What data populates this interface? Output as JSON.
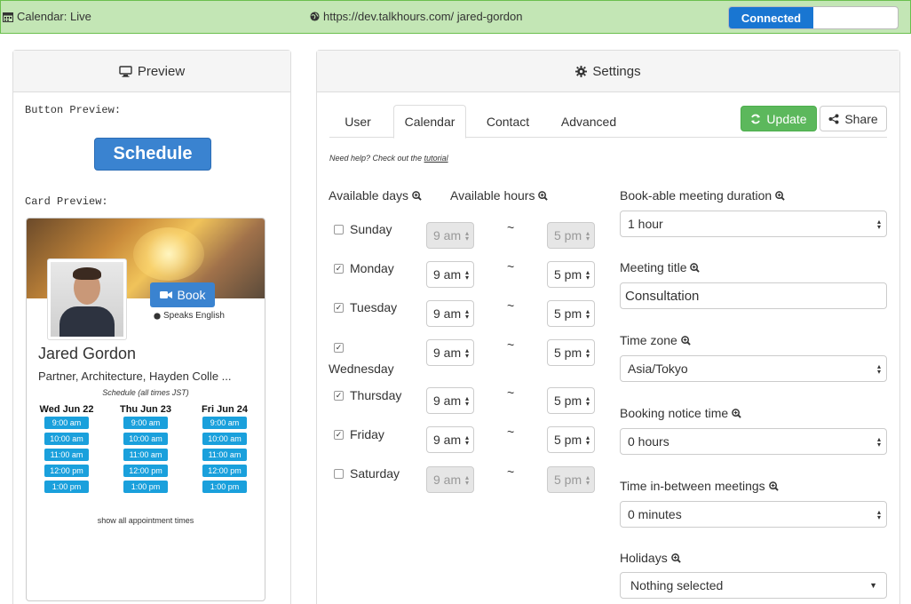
{
  "topbar": {
    "calendar_label": "Calendar: Live",
    "url": "https://dev.talkhours.com/ jared-gordon",
    "toggle_label": "Connected",
    "calendar_icon": "calendar-icon",
    "globe_icon": "globe-icon"
  },
  "preview": {
    "title": "Preview",
    "button_preview_label": "Button Preview:",
    "schedule_label": "Schedule",
    "card_preview_label": "Card Preview:",
    "card": {
      "book_label": "Book",
      "speaks": "Speaks English",
      "name": "Jared Gordon",
      "title": "Partner, Architecture, Hayden Colle ...",
      "schedule_note": "Schedule (all times JST)",
      "days": [
        {
          "label": "Wed Jun 22",
          "slots": [
            "9:00 am",
            "10:00 am",
            "11:00 am",
            "12:00 pm",
            "1:00 pm"
          ]
        },
        {
          "label": "Thu Jun 23",
          "slots": [
            "9:00 am",
            "10:00 am",
            "11:00 am",
            "12:00 pm",
            "1:00 pm"
          ]
        },
        {
          "label": "Fri Jun 24",
          "slots": [
            "9:00 am",
            "10:00 am",
            "11:00 am",
            "12:00 pm",
            "1:00 pm"
          ]
        }
      ],
      "show_all": "show all appointment times"
    }
  },
  "settings": {
    "title": "Settings",
    "tabs": [
      "User",
      "Calendar",
      "Contact",
      "Advanced"
    ],
    "active_tab": "Calendar",
    "update_label": "Update",
    "share_label": "Share",
    "help_prefix": "Need help? Check out the ",
    "help_link": "tutorial",
    "available_days_label": "Available days",
    "available_hours_label": "Available hours",
    "days": [
      {
        "name": "Sunday",
        "checked": false,
        "start": "9 am",
        "end": "5 pm"
      },
      {
        "name": "Monday",
        "checked": true,
        "start": "9 am",
        "end": "5 pm"
      },
      {
        "name": "Tuesday",
        "checked": true,
        "start": "9 am",
        "end": "5 pm"
      },
      {
        "name": "Wednesday",
        "checked": true,
        "start": "9 am",
        "end": "5 pm"
      },
      {
        "name": "Thursday",
        "checked": true,
        "start": "9 am",
        "end": "5 pm"
      },
      {
        "name": "Friday",
        "checked": true,
        "start": "9 am",
        "end": "5 pm"
      },
      {
        "name": "Saturday",
        "checked": false,
        "start": "9 am",
        "end": "5 pm"
      }
    ],
    "tilde": "~",
    "duration_label": "Book-able meeting duration",
    "duration_value": "1 hour",
    "meeting_title_label": "Meeting title",
    "meeting_title_value": "Consultation",
    "timezone_label": "Time zone",
    "timezone_value": "Asia/Tokyo",
    "notice_label": "Booking notice time",
    "notice_value": "0 hours",
    "between_label": "Time in-between meetings",
    "between_value": "0 minutes",
    "holidays_label": "Holidays",
    "holidays_value": "Nothing selected"
  },
  "colors": {
    "topbar_bg": "#c3e6b5",
    "toggle_on": "#1976d2",
    "primary": "#3a83d0",
    "success": "#5cb85c",
    "slot": "#1aa0dc"
  }
}
